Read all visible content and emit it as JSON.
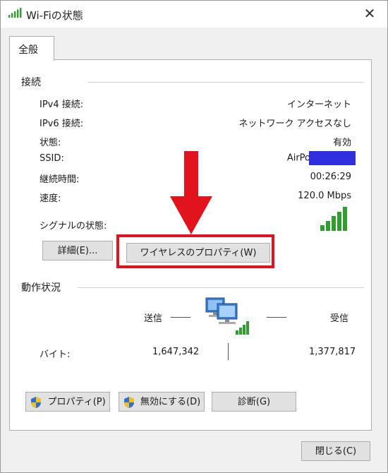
{
  "window": {
    "title": "Wi-Fiの状態",
    "close_glyph": "✕"
  },
  "tabs": [
    {
      "label": "全般"
    }
  ],
  "connection": {
    "label": "接続",
    "rows": [
      {
        "label": "IPv4 接続:",
        "value": "インターネット"
      },
      {
        "label": "IPv6 接続:",
        "value": "ネットワーク アクセスなし"
      },
      {
        "label": "状態:",
        "value": "有効"
      },
      {
        "label": "SSID:",
        "value": "AirPo"
      },
      {
        "label": "継続時間:",
        "value": "00:26:29"
      },
      {
        "label": "速度:",
        "value": "120.0 Mbps"
      }
    ],
    "signal_label": "シグナルの状態:",
    "signal_level": "5/5"
  },
  "buttons": {
    "details": "詳細(E)...",
    "wireless_properties": "ワイヤレスのプロパティ(W)",
    "properties": "プロパティ(P)",
    "disable": "無効にする(D)",
    "diagnose": "診断(G)",
    "close": "閉じる(C)"
  },
  "activity": {
    "label": "動作状況",
    "sent_label": "送信",
    "received_label": "受信",
    "bytes_label": "バイト:",
    "sent_bytes": "1,647,342",
    "received_bytes": "1,377,817"
  },
  "annotation": {
    "arrow_color": "#e1141d",
    "box_color": "#e1141d"
  },
  "colors": {
    "signal_green": "#2f9e2f",
    "ssid_redaction": "#2f2fe0"
  }
}
